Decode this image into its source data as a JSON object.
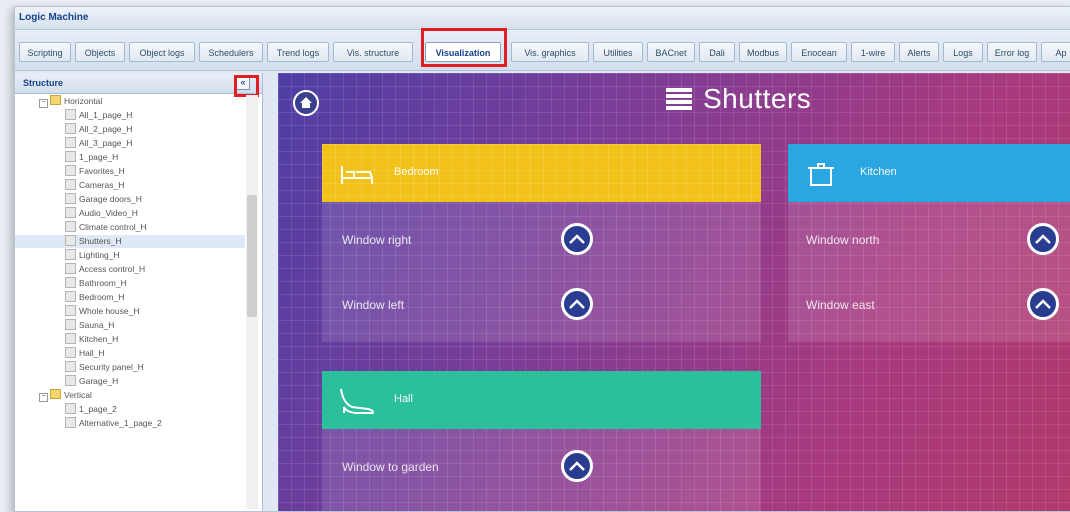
{
  "window": {
    "title": "Logic Machine"
  },
  "tabs": [
    {
      "label": "Scripting"
    },
    {
      "label": "Objects"
    },
    {
      "label": "Object logs"
    },
    {
      "label": "Schedulers"
    },
    {
      "label": "Trend logs"
    },
    {
      "label": "Vis. structure"
    },
    {
      "label": "Visualization",
      "active": true
    },
    {
      "label": "Vis. graphics"
    },
    {
      "label": "Utilities"
    },
    {
      "label": "BACnet"
    },
    {
      "label": "Dali"
    },
    {
      "label": "Modbus"
    },
    {
      "label": "Enocean"
    },
    {
      "label": "1-wire"
    },
    {
      "label": "Alerts"
    },
    {
      "label": "Logs"
    },
    {
      "label": "Error log"
    },
    {
      "label": "Ap"
    }
  ],
  "sidebar": {
    "title": "Structure",
    "collapse_label": "«",
    "tree": [
      {
        "label": "Horizontal",
        "type": "folder",
        "level": 1
      },
      {
        "label": "All_1_page_H",
        "type": "file"
      },
      {
        "label": "All_2_page_H",
        "type": "file"
      },
      {
        "label": "All_3_page_H",
        "type": "file"
      },
      {
        "label": "1_page_H",
        "type": "file"
      },
      {
        "label": "Favorites_H",
        "type": "file"
      },
      {
        "label": "Cameras_H",
        "type": "file"
      },
      {
        "label": "Garage doors_H",
        "type": "file"
      },
      {
        "label": "Audio_Video_H",
        "type": "file"
      },
      {
        "label": "Climate control_H",
        "type": "file"
      },
      {
        "label": "Shutters_H",
        "type": "file",
        "selected": true
      },
      {
        "label": "Lighting_H",
        "type": "file"
      },
      {
        "label": "Access control_H",
        "type": "file"
      },
      {
        "label": "Bathroom_H",
        "type": "file"
      },
      {
        "label": "Bedroom_H",
        "type": "file"
      },
      {
        "label": "Whole house_H",
        "type": "file"
      },
      {
        "label": "Sauna_H",
        "type": "file"
      },
      {
        "label": "Kitchen_H",
        "type": "file"
      },
      {
        "label": "Hall_H",
        "type": "file"
      },
      {
        "label": "Security panel_H",
        "type": "file"
      },
      {
        "label": "Garage_H",
        "type": "file"
      },
      {
        "label": "Vertical",
        "type": "folder",
        "level": 1
      },
      {
        "label": "1_page_2",
        "type": "file"
      },
      {
        "label": "Alternative_1_page_2",
        "type": "file"
      }
    ]
  },
  "vis": {
    "title": "Shutters",
    "panels": [
      {
        "name": "Bedroom",
        "color": "#f2c21b",
        "icon": "bed-icon",
        "rows": [
          "Window right",
          "Window left"
        ]
      },
      {
        "name": "Kitchen",
        "color": "#2aa6e0",
        "icon": "pot-icon",
        "rows": [
          "Window north",
          "Window east"
        ]
      },
      {
        "name": "Hall",
        "color": "#2bbf9c",
        "icon": "heel-icon",
        "rows": [
          "Window to garden"
        ]
      }
    ]
  },
  "colors": {
    "highlight": "#e01e24",
    "accent": "#15428b"
  }
}
